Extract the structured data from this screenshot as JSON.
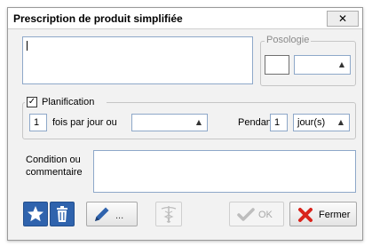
{
  "window": {
    "title": "Prescription de produit simplifiée",
    "close_glyph": "✕"
  },
  "posologie": {
    "legend": "Posologie",
    "unit_value": ""
  },
  "planification": {
    "checkbox_glyph": "✓",
    "checked": true,
    "label": "Planification",
    "frequency_value": "1",
    "frequency_label": "fois par jour ou",
    "interval_value": "",
    "duration_label": "Pendant",
    "duration_value": "1",
    "duration_unit": "jour(s)"
  },
  "comment": {
    "label": "Condition ou commentaire",
    "value": ""
  },
  "toolbar": {
    "more_label": "...",
    "ok_label": "OK",
    "cancel_label": "Fermer"
  },
  "icons": {
    "dropdown_arrow": "▲",
    "favorite": "star-icon",
    "delete": "trash-icon",
    "edit": "pencil-icon",
    "caduceus": "caduceus-icon",
    "ok": "check-icon",
    "close": "red-x-icon"
  },
  "colors": {
    "accent_blue": "#2f63ad",
    "close_red": "#d9241c",
    "disabled_gray": "#bdbdbd"
  }
}
